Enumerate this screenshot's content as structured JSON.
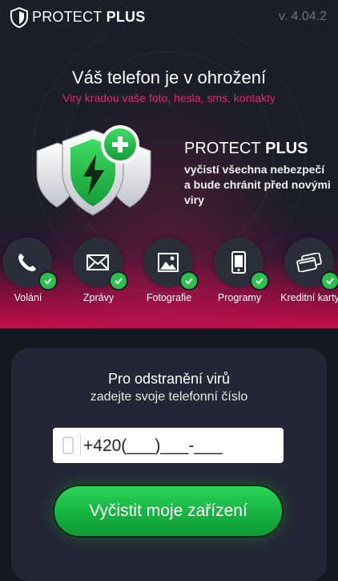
{
  "header": {
    "brand_part1": "PROTECT",
    "brand_part2": " PLUS",
    "version": "v. 4.04.2"
  },
  "hero": {
    "title": "Váš telefon je v ohrožení",
    "subtitle": "Viry kradou vaše foto, hesla, sms, kontakty",
    "product_part1": "PROTECT",
    "product_part2": " PLUS",
    "description": "vyčistí všechna nebezpečí a bude chránit před novými viry"
  },
  "features": [
    {
      "label": "Volání",
      "icon": "phone-handset-icon"
    },
    {
      "label": "Zprávy",
      "icon": "envelope-icon"
    },
    {
      "label": "Fotografie",
      "icon": "photo-icon"
    },
    {
      "label": "Programy",
      "icon": "smartphone-icon"
    },
    {
      "label": "Kreditní karty",
      "icon": "credit-card-icon"
    }
  ],
  "form": {
    "title": "Pro odstranění virů",
    "subtitle": "zadejte svoje telefonní číslo",
    "phone_value": "+420(___)___-___",
    "submit_label": "Vyčistit moje zařízení"
  },
  "colors": {
    "accent_pink": "#e3286a",
    "button_green": "#1fbf4a",
    "check_green": "#2fbf4c",
    "background": "#141822"
  }
}
